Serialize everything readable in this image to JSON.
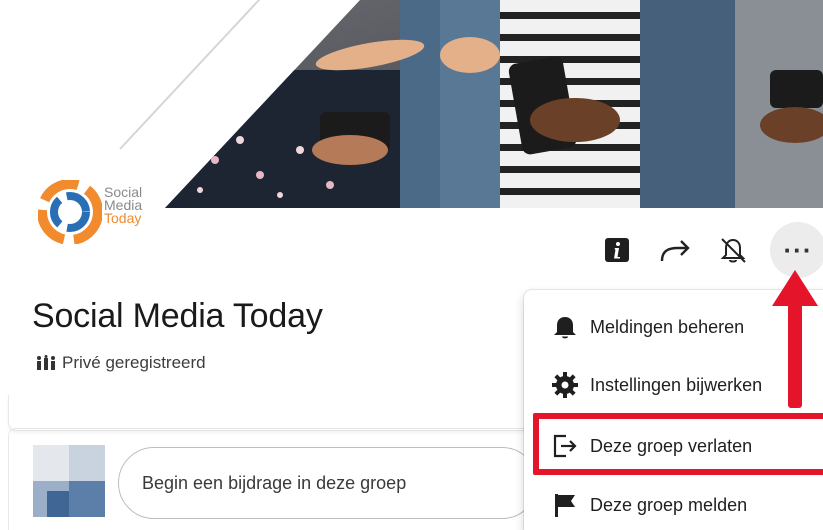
{
  "group": {
    "name": "Social Media Today",
    "privacy": "Privé geregistreerd"
  },
  "logo": {
    "line1": "Social",
    "line2": "Media",
    "line3": "Today"
  },
  "toolbar": {
    "info_icon": "info-icon",
    "share_icon": "share-arrow-icon",
    "notifications_icon": "bell-off-icon",
    "more_label": "···"
  },
  "composer": {
    "placeholder": "Begin een bijdrage in deze groep"
  },
  "menu": {
    "items": [
      {
        "label": "Meldingen beheren",
        "icon": "bell-icon"
      },
      {
        "label": "Instellingen bijwerken",
        "icon": "gear-icon"
      },
      {
        "label": "Deze groep verlaten",
        "icon": "leave-icon"
      },
      {
        "label": "Deze groep melden",
        "icon": "flag-icon"
      }
    ]
  },
  "colors": {
    "highlight": "#e4152a",
    "logo_orange": "#f28a2e",
    "logo_blue": "#2a6fb5"
  }
}
